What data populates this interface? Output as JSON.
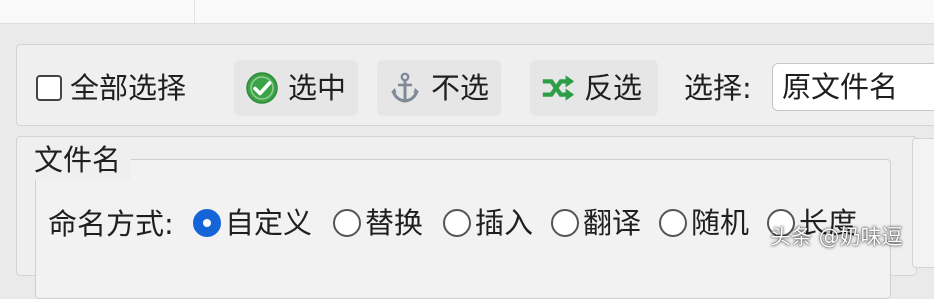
{
  "colors": {
    "accent": "#1565d8",
    "check_icon": "#3aa346",
    "shuffle_icon": "#2e9e46",
    "anchor_icon": "#808a96"
  },
  "toolbar": {
    "select_all_label": "全部选择",
    "check_label": "选中",
    "uncheck_label": "不选",
    "invert_label": "反选",
    "select_label": "选择:",
    "select_value": "原文件名"
  },
  "filename_group": {
    "title": "文件名",
    "naming_label": "命名方式:",
    "options": [
      {
        "label": "自定义",
        "checked": true
      },
      {
        "label": "替换",
        "checked": false
      },
      {
        "label": "插入",
        "checked": false
      },
      {
        "label": "翻译",
        "checked": false
      },
      {
        "label": "随机",
        "checked": false
      },
      {
        "label": "长度",
        "checked": false
      }
    ]
  },
  "watermark": "头条 @奶味逗",
  "icons": [
    "checkbox-icon",
    "check-circle-icon",
    "anchor-icon",
    "shuffle-icon",
    "radio-icon"
  ]
}
